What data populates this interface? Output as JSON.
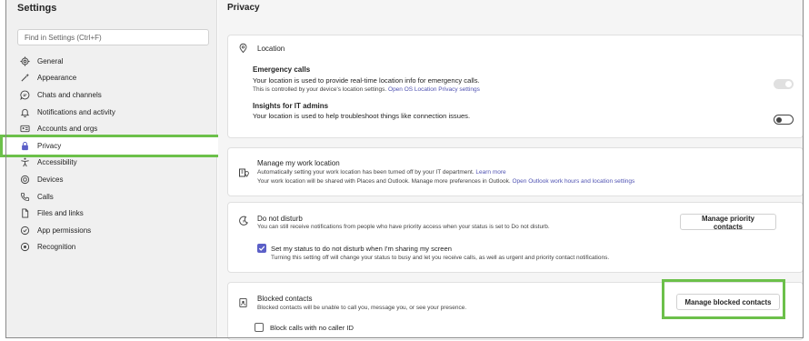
{
  "sidebar": {
    "title": "Settings",
    "search_placeholder": "Find in Settings (Ctrl+F)",
    "items": [
      {
        "label": "General",
        "icon": "gear-icon"
      },
      {
        "label": "Appearance",
        "icon": "magic-wand-icon"
      },
      {
        "label": "Chats and channels",
        "icon": "chat-icon"
      },
      {
        "label": "Notifications and activity",
        "icon": "bell-icon"
      },
      {
        "label": "Accounts and orgs",
        "icon": "id-card-icon"
      },
      {
        "label": "Privacy",
        "icon": "lock-icon"
      },
      {
        "label": "Accessibility",
        "icon": "accessibility-icon"
      },
      {
        "label": "Devices",
        "icon": "devices-icon"
      },
      {
        "label": "Calls",
        "icon": "phone-icon"
      },
      {
        "label": "Files and links",
        "icon": "file-icon"
      },
      {
        "label": "App permissions",
        "icon": "permissions-icon"
      },
      {
        "label": "Recognition",
        "icon": "recognition-icon"
      }
    ],
    "active": "Privacy"
  },
  "main": {
    "title": "Privacy",
    "location": {
      "title": "Location",
      "emergency_title": "Emergency calls",
      "emergency_desc": "Your location is used to provide real-time location info for emergency calls.",
      "emergency_note": "This is controlled by your device's location settings.",
      "emergency_link": "Open OS Location Privacy settings",
      "emergency_toggle": "on-disabled",
      "insights_title": "Insights for IT admins",
      "insights_desc": "Your location is used to help troubleshoot things like connection issues.",
      "insights_toggle": "off"
    },
    "work_location": {
      "title": "Manage my work location",
      "line1": "Automatically setting your work location has been turned off by your IT department.",
      "line1_link": "Learn more",
      "line2": "Your work location will be shared with Places and Outlook. Manage more preferences in Outlook.",
      "line2_link": "Open Outlook work hours and location settings"
    },
    "dnd": {
      "title": "Do not disturb",
      "desc": "You can still receive notifications from people who have priority access when your status is set to Do not disturb.",
      "button": "Manage priority contacts",
      "checkbox_label": "Set my status to do not disturb when I'm sharing my screen",
      "checkbox_checked": true,
      "checkbox_note": "Turning this setting off will change your status to busy and let you receive calls, as well as urgent and priority contact notifications."
    },
    "blocked": {
      "title": "Blocked contacts",
      "desc": "Blocked contacts will be unable to call you, message you, or see your presence.",
      "button": "Manage blocked contacts",
      "checkbox_label": "Block calls with no caller ID",
      "checkbox_checked": false
    }
  },
  "colors": {
    "highlight": "#6cc04a",
    "accent": "#5b5fc7",
    "link": "#4f52b2",
    "sidebar_bg": "#f0f0f0",
    "main_bg": "#f5f5f5"
  }
}
